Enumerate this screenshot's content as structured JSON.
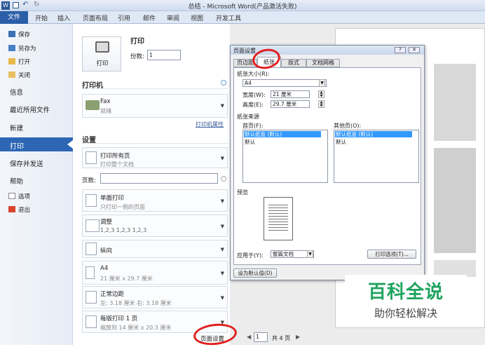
{
  "window": {
    "title": "总结 - Microsoft Word(产品激活失败)"
  },
  "ribbon": {
    "tabs": [
      "文件",
      "开始",
      "插入",
      "页面布局",
      "引用",
      "邮件",
      "审阅",
      "视图",
      "开发工具"
    ]
  },
  "nav": {
    "save": "保存",
    "save_as": "另存为",
    "open": "打开",
    "close": "关闭",
    "info": "信息",
    "recent": "最近所用文件",
    "new": "新建",
    "print": "打印",
    "save_send": "保存并发送",
    "help": "帮助",
    "options": "选项",
    "exit": "退出"
  },
  "print": {
    "title": "打印",
    "button": "打印",
    "copies_label": "份数:",
    "copies": "1",
    "printer_header": "打印机",
    "printer_name": "Fax",
    "printer_status": "就绪",
    "printer_props": "打印机属性",
    "settings_header": "设置",
    "dd1": [
      "打印所有页",
      "打印整个文档"
    ],
    "pages_label": "页数:",
    "dd2": [
      "单面打印",
      "只打印一侧的页面"
    ],
    "dd3": [
      "调整",
      "1,2,3    1,2,3    1,2,3"
    ],
    "dd4": [
      "纵向",
      ""
    ],
    "dd5": [
      "A4",
      "21 厘米 x 29.7 厘米"
    ],
    "dd6": [
      "正常边距",
      "左: 3.18 厘米    右: 3.18 厘米"
    ],
    "dd7": [
      "每版打印 1 页",
      "缩放到 14 厘米 x 20.3 厘米"
    ],
    "page_setup_link": "页面设置"
  },
  "pager": {
    "current": "1",
    "total": "共 4 页"
  },
  "dialog": {
    "title": "页面设置",
    "tabs": [
      "页边距",
      "纸张",
      "版式",
      "文档网格"
    ],
    "paper_size_group": "纸张大小(R):",
    "paper_size": "A4",
    "width_label": "宽度(W):",
    "width": "21 厘米",
    "height_label": "高度(E):",
    "height": "29.7 厘米",
    "source_group": "纸张来源",
    "first_page_label": "首页(F):",
    "other_pages_label": "其他页(O):",
    "list_selected": "默认纸盒 (默认)",
    "list_item": "默认",
    "preview_label": "预览",
    "apply_label": "应用于(Y):",
    "apply_value": "整篇文档",
    "print_options": "打印选项(T)...",
    "default_btn": "设为默认值(D)"
  },
  "watermark": {
    "line1": "百科全说",
    "line2": "助你轻松解决"
  }
}
